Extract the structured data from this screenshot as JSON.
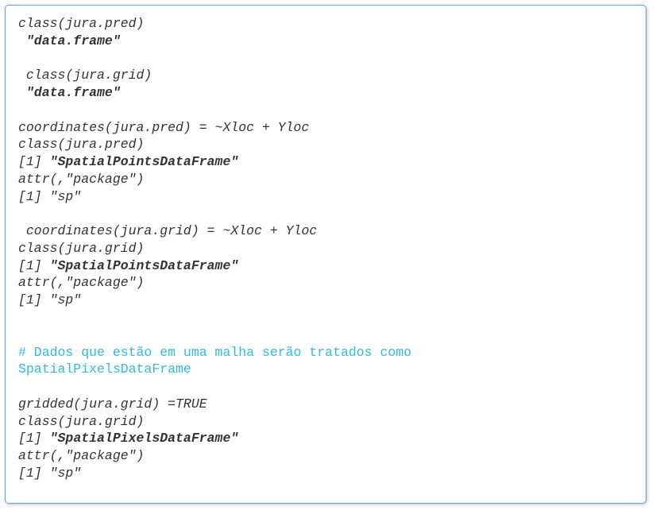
{
  "lines": [
    {
      "t": "class(jura.pred)"
    },
    {
      "t": " \"data.frame\"",
      "style": "b"
    },
    {
      "t": ""
    },
    {
      "t": " class(jura.grid)"
    },
    {
      "t": " \"data.frame\"",
      "style": "b"
    },
    {
      "t": ""
    },
    {
      "t": "coordinates(jura.pred) = ~Xloc + Yloc"
    },
    {
      "t": "class(jura.pred)"
    },
    {
      "parts": [
        {
          "t": "[1] "
        },
        {
          "t": "\"SpatialPointsDataFrame\"",
          "style": "b"
        }
      ]
    },
    {
      "t": "attr(,\"package\")"
    },
    {
      "t": "[1] \"sp\""
    },
    {
      "t": ""
    },
    {
      "t": " coordinates(jura.grid) = ~Xloc + Yloc"
    },
    {
      "t": "class(jura.grid)"
    },
    {
      "parts": [
        {
          "t": "[1] "
        },
        {
          "t": "\"SpatialPointsDataFrame\"",
          "style": "b"
        }
      ]
    },
    {
      "t": "attr(,\"package\")"
    },
    {
      "t": "[1] \"sp\""
    },
    {
      "t": ""
    },
    {
      "t": ""
    },
    {
      "t": "# Dados que estão em uma malha serão tratados como ",
      "style": "comment"
    },
    {
      "t": "SpatialPixelsDataFrame",
      "style": "comment"
    },
    {
      "t": ""
    },
    {
      "t": "gridded(jura.grid) =TRUE"
    },
    {
      "t": "class(jura.grid)"
    },
    {
      "parts": [
        {
          "t": "[1] "
        },
        {
          "t": "\"SpatialPixelsDataFrame\"",
          "style": "b"
        }
      ]
    },
    {
      "t": "attr(,\"package\")"
    },
    {
      "t": "[1] \"sp\""
    }
  ]
}
